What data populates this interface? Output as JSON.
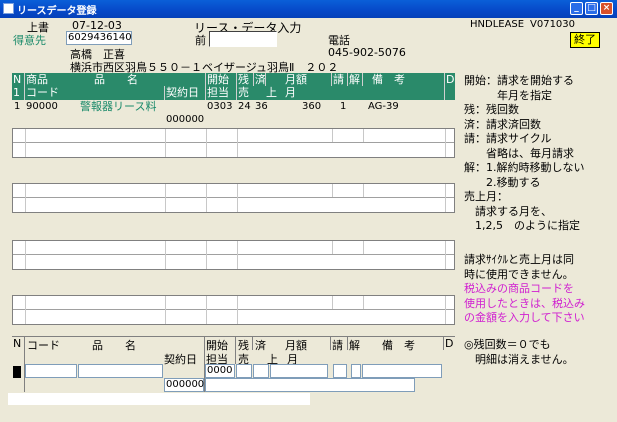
{
  "window": {
    "title": "リースデータ登録"
  },
  "header": {
    "ueki_label": "上書",
    "date": "07-12-03",
    "screen_title": "リース・データ入力",
    "company": "HNDLEASE",
    "version": "V071030",
    "end_button": "終了",
    "customer_label": "得意先",
    "customer_code": "6029436140",
    "prev_label": "前",
    "prev_value": "",
    "phone_label": "電話",
    "phone_value": "045-902-5076",
    "customer_name": "高橋　正喜",
    "address": "横浜市西区羽鳥５５０－１ベイザージュ羽鳥Ⅱ　２０２"
  },
  "table_header": {
    "n": "N",
    "n2": "1",
    "product": "商品",
    "code": "コード",
    "name": "品　　名",
    "start": "開始",
    "person": "担当",
    "remaining": "残",
    "sales": "売",
    "done": "済",
    "up": "上",
    "monthly": "月額",
    "month": "月",
    "bill": "請",
    "cancel": "解",
    "remarks": "備　考",
    "d": "D",
    "contract_day": "契約日"
  },
  "rows": [
    {
      "n": "1",
      "code": "90000",
      "name": "警報器リース料",
      "start": "0303",
      "remaining": "24",
      "done": "36",
      "monthly": "360",
      "bill": "1",
      "cancel": "",
      "remarks": "AG-39",
      "contract": "000000"
    }
  ],
  "input_header": {
    "n": "N",
    "code": "コード",
    "name": "品　　名",
    "start": "開始",
    "remaining": "残",
    "done": "済",
    "monthly": "月額",
    "bill": "請",
    "cancel": "解",
    "remarks": "備　考",
    "d": "D",
    "contract_day": "契約日",
    "person": "担当",
    "sales": "売",
    "up": "上",
    "month": "月"
  },
  "input_row": {
    "start": "0000",
    "contract": "000000"
  },
  "notes": [
    "開始：請求を開始する",
    "　　　年月を指定",
    "残：残回数",
    "済：請求済回数",
    "請：請求サイクル",
    "　　省略は、毎月請求",
    "解：1.解約時移動しない",
    "　　2.移動する",
    "売上月：",
    "　請求する月を、",
    "　1,2,5　のように指定"
  ],
  "notes2": [
    "請求ｻｲｸﾙと売上月は同",
    "時に使用できません。"
  ],
  "notes_pink": [
    "税込みの商品コードを",
    "使用したときは、税込み",
    "の金額を入力して下さい"
  ],
  "notes3": [
    "◎残回数＝０でも",
    "　明細は消えません。"
  ],
  "colors": {
    "header_bg": "#2a8a6a",
    "teal_text": "#1a8a6a",
    "pink_text": "#d020d0",
    "end_button": "#ffff00"
  }
}
